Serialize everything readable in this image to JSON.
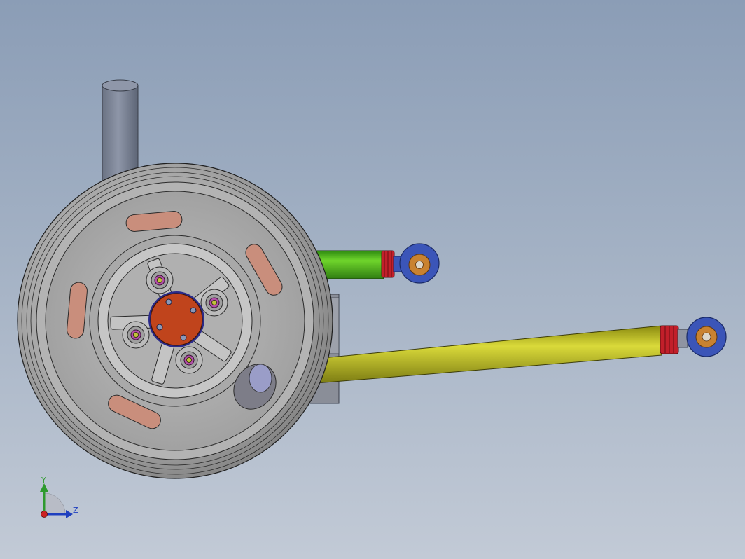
{
  "viewport": {
    "background_top": "#8b9db6",
    "background_bottom": "#c2cad6"
  },
  "triad": {
    "y_label": "Y",
    "z_label": "Z",
    "colors": {
      "y": "#2e9a2e",
      "z": "#1e3fbf",
      "x": "#cc2222"
    }
  },
  "model": {
    "parts": [
      {
        "name": "damper-tube",
        "color": "#7c8496"
      },
      {
        "name": "wheel-rim",
        "color": "#9a9a9a"
      },
      {
        "name": "hub-cap",
        "color": "#c0441c"
      },
      {
        "name": "wheel-lightening-slots",
        "color": "#c98e7c"
      },
      {
        "name": "upper-control-arm",
        "color": "#55c020"
      },
      {
        "name": "lower-control-arm",
        "color": "#c5c520"
      },
      {
        "name": "rod-end-housing",
        "color": "#3b55b8"
      },
      {
        "name": "rod-end-bearing",
        "color": "#c98230"
      },
      {
        "name": "jam-nut",
        "color": "#c21f2a"
      },
      {
        "name": "upright-bracket",
        "color": "#8a8e98"
      }
    ]
  }
}
